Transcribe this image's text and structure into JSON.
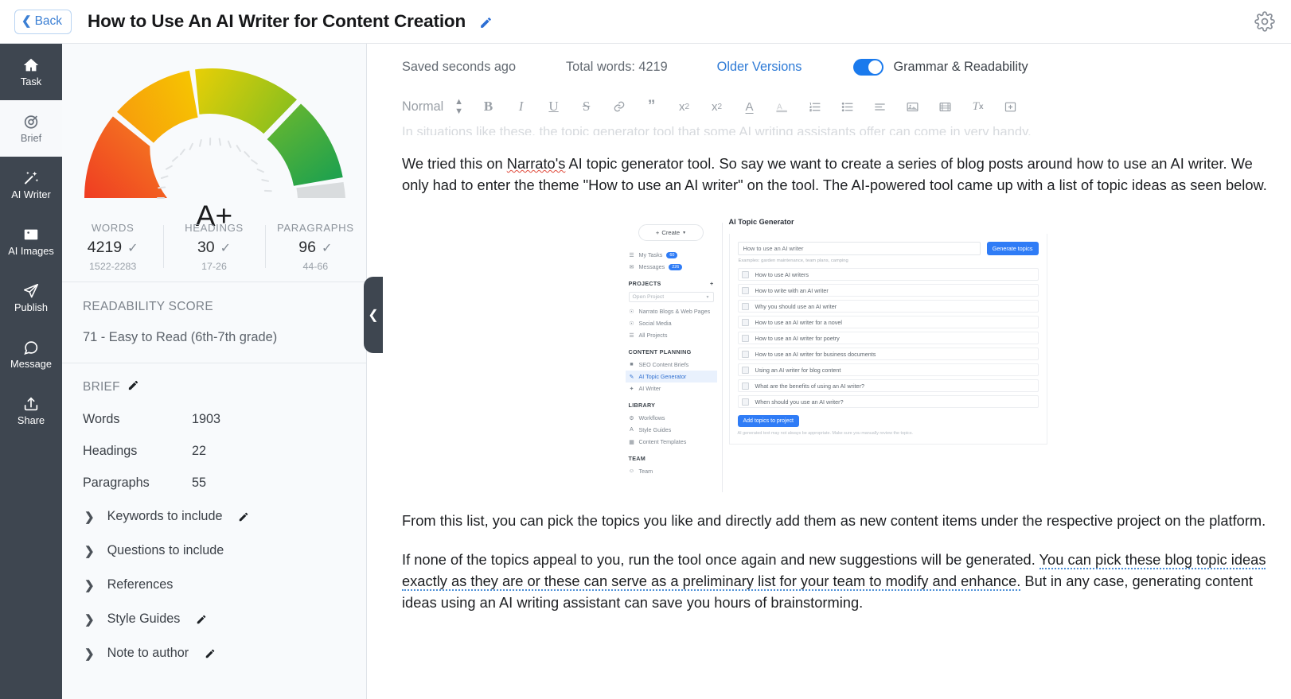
{
  "topbar": {
    "back_label": "Back",
    "back_chevron": "chevron-left-icon",
    "title": "How to Use An AI Writer for Content Creation",
    "title_edit_icon": "edit-pencil-icon",
    "settings_icon": "gear-icon"
  },
  "rail": {
    "items": [
      {
        "label": "Task",
        "icon": "home-icon",
        "active": false
      },
      {
        "label": "Brief",
        "icon": "target-icon",
        "active": true
      },
      {
        "label": "AI Writer",
        "icon": "magic-wand-icon",
        "active": false
      },
      {
        "label": "AI Images",
        "icon": "image-icon",
        "active": false
      },
      {
        "label": "Publish",
        "icon": "paper-plane-icon",
        "active": false
      },
      {
        "label": "Message",
        "icon": "chat-bubble-icon",
        "active": false
      },
      {
        "label": "Share",
        "icon": "share-upload-icon",
        "active": false
      }
    ]
  },
  "score_panel": {
    "grade": "A+",
    "gauge": {
      "segments": [
        "red-orange",
        "orange-yellow",
        "yellow-green",
        "green",
        "grey-remainder"
      ],
      "colors": [
        "#ef4123",
        "#f49c0c",
        "#f5c400",
        "#9ec519",
        "#34a84a",
        "#d9dcdd"
      ]
    },
    "stats": [
      {
        "label": "WORDS",
        "value": "4219",
        "range": "1522-2283",
        "check": "check-icon"
      },
      {
        "label": "HEADINGS",
        "value": "30",
        "range": "17-26",
        "check": "check-icon"
      },
      {
        "label": "PARAGRAPHS",
        "value": "96",
        "range": "44-66",
        "check": "check-icon"
      }
    ],
    "readability": {
      "title": "READABILITY SCORE",
      "value": "71 - Easy to Read (6th-7th grade)"
    },
    "brief": {
      "heading": "BRIEF",
      "heading_edit_icon": "edit-pencil-icon",
      "rows": [
        {
          "key": "Words",
          "value": "1903"
        },
        {
          "key": "Headings",
          "value": "22"
        },
        {
          "key": "Paragraphs",
          "value": "55"
        }
      ],
      "accordion": [
        {
          "label": "Keywords to include",
          "has_edit": true
        },
        {
          "label": "Questions to include",
          "has_edit": false
        },
        {
          "label": "References",
          "has_edit": false
        },
        {
          "label": "Style Guides",
          "has_edit": true
        },
        {
          "label": "Note to author",
          "has_edit": true
        }
      ]
    },
    "collapse_handle_icon": "chevron-left-icon"
  },
  "editor": {
    "status": {
      "saved": "Saved seconds ago",
      "total_words": "Total words: 4219",
      "older_versions": "Older Versions",
      "toggle_label": "Grammar & Readability",
      "toggle_on": true,
      "accent": "#1a7aed"
    },
    "toolbar": {
      "style_value": "Normal",
      "buttons": [
        {
          "name": "bold-icon",
          "glyph": "B"
        },
        {
          "name": "italic-icon",
          "glyph": "I"
        },
        {
          "name": "underline-icon",
          "glyph": "U"
        },
        {
          "name": "strikethrough-icon",
          "glyph": "S"
        },
        {
          "name": "link-icon",
          "glyph": "&"
        },
        {
          "name": "blockquote-icon",
          "glyph": "”"
        },
        {
          "name": "subscript-icon",
          "glyph": "x₂"
        },
        {
          "name": "superscript-icon",
          "glyph": "x²"
        },
        {
          "name": "text-color-icon",
          "glyph": "A"
        },
        {
          "name": "highlight-color-icon",
          "glyph": "A"
        },
        {
          "name": "ordered-list-icon",
          "glyph": "list"
        },
        {
          "name": "bullet-list-icon",
          "glyph": "list"
        },
        {
          "name": "align-icon",
          "glyph": "align"
        },
        {
          "name": "insert-image-icon",
          "glyph": "image"
        },
        {
          "name": "insert-video-icon",
          "glyph": "video"
        },
        {
          "name": "clear-format-icon",
          "glyph": "Tx"
        },
        {
          "name": "insert-widget-icon",
          "glyph": "+"
        }
      ]
    },
    "content": {
      "clipped_line": "In situations like these, the topic generator tool that some AI writing assistants offer can come in very handy.",
      "para1_a": "We tried this on ",
      "para1_spell": "Narrato's",
      "para1_b": " AI topic generator tool. So say we want to create a series of blog posts around how to use an AI writer. We only had to enter the theme \"How to use an AI writer\" on the tool. The AI-powered tool came up with a list of topic ideas as seen below.",
      "para2": "From this list, you can pick the topics you like and directly add them as new content items under the respective project on the platform.",
      "para3_a": "If none of the topics appeal to you, run the tool once again and new suggestions will be generated. ",
      "para3_grammar": "You can pick these blog topic ideas exactly as they are or these can serve as a preliminary list for your team to modify and enhance.",
      "para3_b": " But in any case, generating content ideas using an AI writing assistant can save you hours of brainstorming."
    }
  },
  "embedded_screenshot": {
    "sidebar": {
      "create_label": "Create",
      "create_icon": "plus-icon",
      "rows": [
        {
          "label": "My Tasks",
          "badge": "60",
          "icon": "tasks-icon"
        },
        {
          "label": "Messages",
          "badge": "226",
          "icon": "mail-icon"
        }
      ],
      "sections": [
        {
          "title": "PROJECTS",
          "has_add": true,
          "select_placeholder": "Open Project",
          "items": [
            {
              "label": "Narrato Blogs & Web Pages",
              "icon": "project-icon",
              "selected": false
            },
            {
              "label": "Social Media",
              "icon": "project-icon",
              "selected": false
            },
            {
              "label": "All Projects",
              "icon": "list-icon",
              "selected": false
            }
          ]
        },
        {
          "title": "CONTENT PLANNING",
          "has_add": false,
          "items": [
            {
              "label": "SEO Content Briefs",
              "icon": "document-icon",
              "selected": false
            },
            {
              "label": "AI Topic Generator",
              "icon": "pen-icon",
              "selected": true
            },
            {
              "label": "AI Writer",
              "icon": "magic-wand-icon",
              "selected": false
            }
          ]
        },
        {
          "title": "LIBRARY",
          "has_add": false,
          "items": [
            {
              "label": "Workflows",
              "icon": "workflow-icon",
              "selected": false
            },
            {
              "label": "Style Guides",
              "icon": "font-icon",
              "selected": false
            },
            {
              "label": "Content Templates",
              "icon": "template-icon",
              "selected": false
            }
          ]
        },
        {
          "title": "TEAM",
          "has_add": false,
          "items": []
        }
      ]
    },
    "main": {
      "title": "AI Topic Generator",
      "input_value": "How to use an AI writer",
      "generate_button": "Generate topics",
      "hint": "Examples: garden maintenance, team plans, camping",
      "topics": [
        "How to use AI writers",
        "How to write with an AI writer",
        "Why you should use an AI writer",
        "How to use an AI writer for a novel",
        "How to use an AI writer for poetry",
        "How to use an AI writer for business documents",
        "Using an AI writer for blog content",
        "What are the benefits of using an AI writer?",
        "When should you use an AI writer?"
      ],
      "add_button": "Add topics to project",
      "footnote": "AI generated text may not always be appropriate. Make sure you manually review the topics."
    }
  }
}
